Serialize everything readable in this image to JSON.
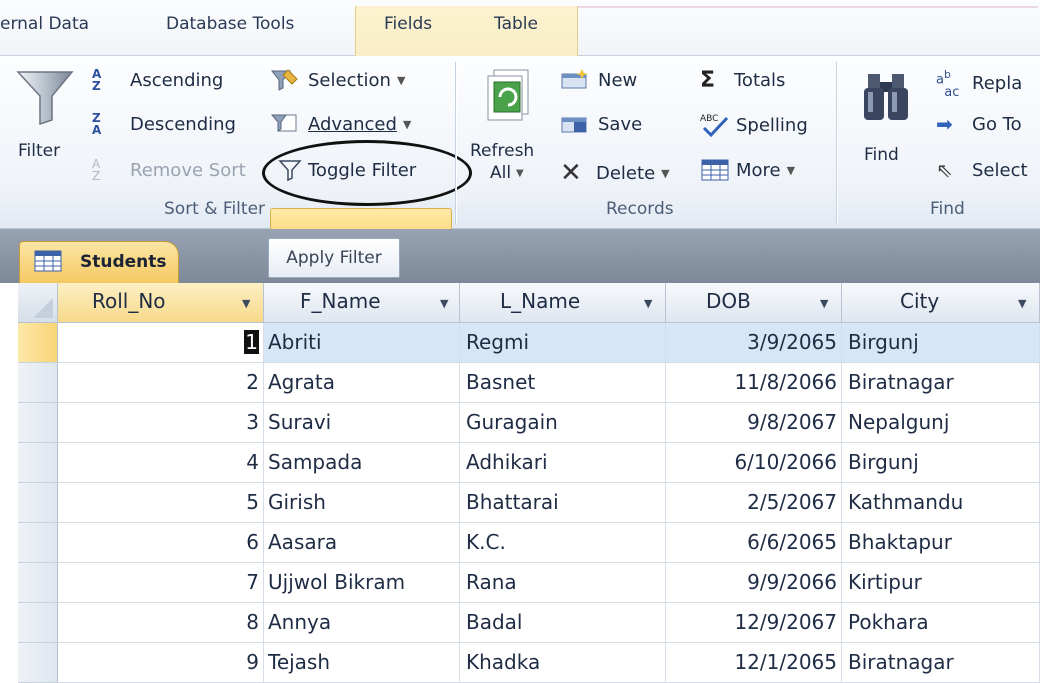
{
  "tabs": [
    "ernal Data",
    "Database Tools",
    "Fields",
    "Table"
  ],
  "ribbon": {
    "sort_filter": {
      "filter": "Filter",
      "ascending": "Ascending",
      "descending": "Descending",
      "remove_sort": "Remove Sort",
      "selection": "Selection",
      "advanced": "Advanced",
      "toggle_filter": "Toggle Filter",
      "group_label": "Sort & Filter"
    },
    "records": {
      "refresh": "Refresh",
      "refresh_all": "All",
      "new": "New",
      "save": "Save",
      "delete": "Delete",
      "totals": "Totals",
      "spelling": "Spelling",
      "more": "More",
      "group_label": "Records"
    },
    "find": {
      "find": "Find",
      "replace": "Repla",
      "go_to": "Go To",
      "select": "Select",
      "group_label": "Find"
    }
  },
  "tooltip": "Apply Filter",
  "document_tab": "Students",
  "columns": [
    "Roll_No",
    "F_Name",
    "L_Name",
    "DOB",
    "City"
  ],
  "rows": [
    {
      "roll": "1",
      "fname": "Abriti",
      "lname": "Regmi",
      "dob": "3/9/2065",
      "city": "Birgunj"
    },
    {
      "roll": "2",
      "fname": "Agrata",
      "lname": "Basnet",
      "dob": "11/8/2066",
      "city": "Biratnagar"
    },
    {
      "roll": "3",
      "fname": "Suravi",
      "lname": "Guragain",
      "dob": "9/8/2067",
      "city": "Nepalgunj"
    },
    {
      "roll": "4",
      "fname": "Sampada",
      "lname": "Adhikari",
      "dob": "6/10/2066",
      "city": "Birgunj"
    },
    {
      "roll": "5",
      "fname": "Girish",
      "lname": "Bhattarai",
      "dob": "2/5/2067",
      "city": "Kathmandu"
    },
    {
      "roll": "6",
      "fname": "Aasara",
      "lname": "K.C.",
      "dob": "6/6/2065",
      "city": "Bhaktapur"
    },
    {
      "roll": "7",
      "fname": "Ujjwol Bikram",
      "lname": "Rana",
      "dob": "9/9/2066",
      "city": "Kirtipur"
    },
    {
      "roll": "8",
      "fname": "Annya",
      "lname": "Badal",
      "dob": "12/9/2067",
      "city": "Pokhara"
    },
    {
      "roll": "9",
      "fname": "Tejash",
      "lname": "Khadka",
      "dob": "12/1/2065",
      "city": "Biratnagar"
    }
  ]
}
